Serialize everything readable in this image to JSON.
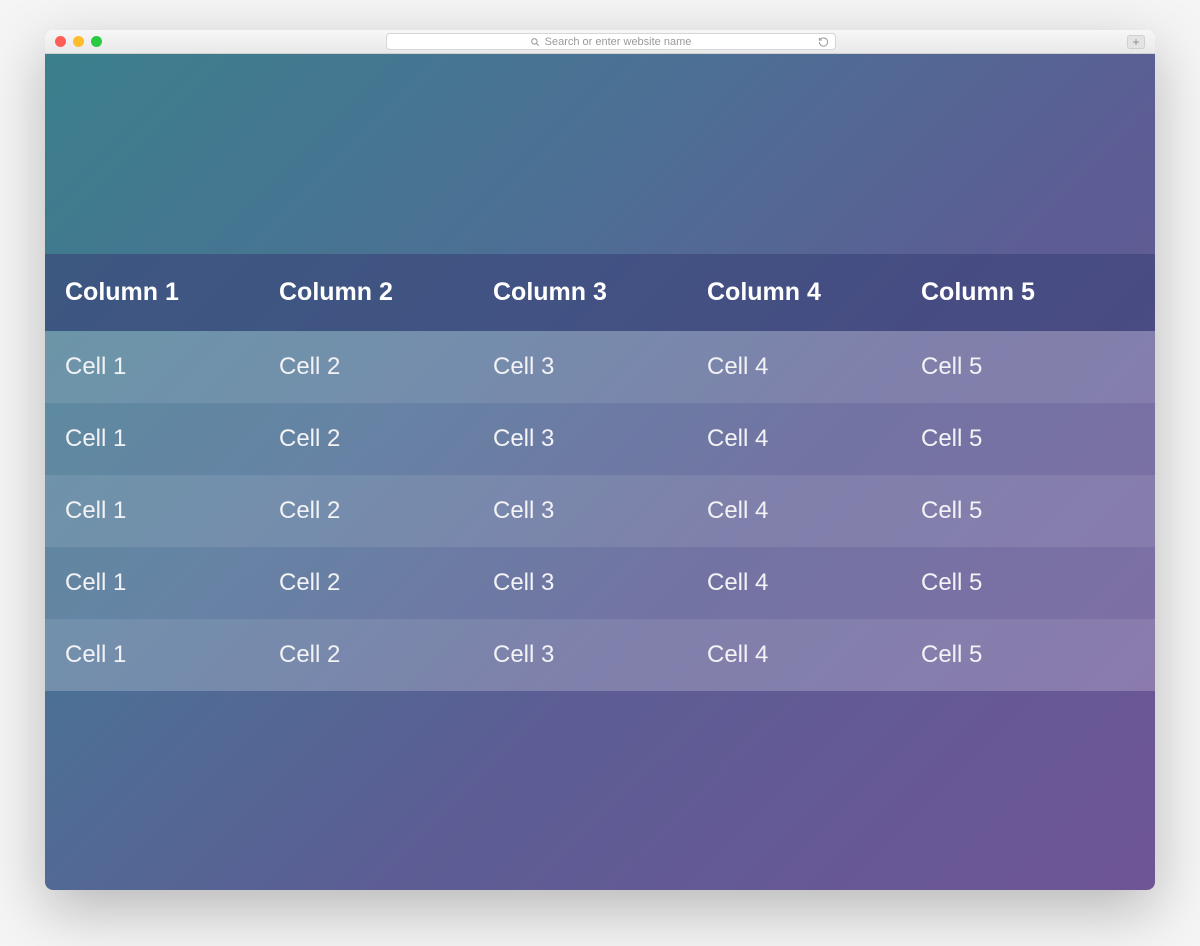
{
  "browser": {
    "address_placeholder": "Search or enter website name",
    "new_tab_label": "+"
  },
  "table": {
    "headers": [
      "Column 1",
      "Column 2",
      "Column 3",
      "Column 4",
      "Column 5"
    ],
    "rows": [
      [
        "Cell 1",
        "Cell 2",
        "Cell 3",
        "Cell 4",
        "Cell 5"
      ],
      [
        "Cell 1",
        "Cell 2",
        "Cell 3",
        "Cell 4",
        "Cell 5"
      ],
      [
        "Cell 1",
        "Cell 2",
        "Cell 3",
        "Cell 4",
        "Cell 5"
      ],
      [
        "Cell 1",
        "Cell 2",
        "Cell 3",
        "Cell 4",
        "Cell 5"
      ],
      [
        "Cell 1",
        "Cell 2",
        "Cell 3",
        "Cell 4",
        "Cell 5"
      ]
    ]
  }
}
